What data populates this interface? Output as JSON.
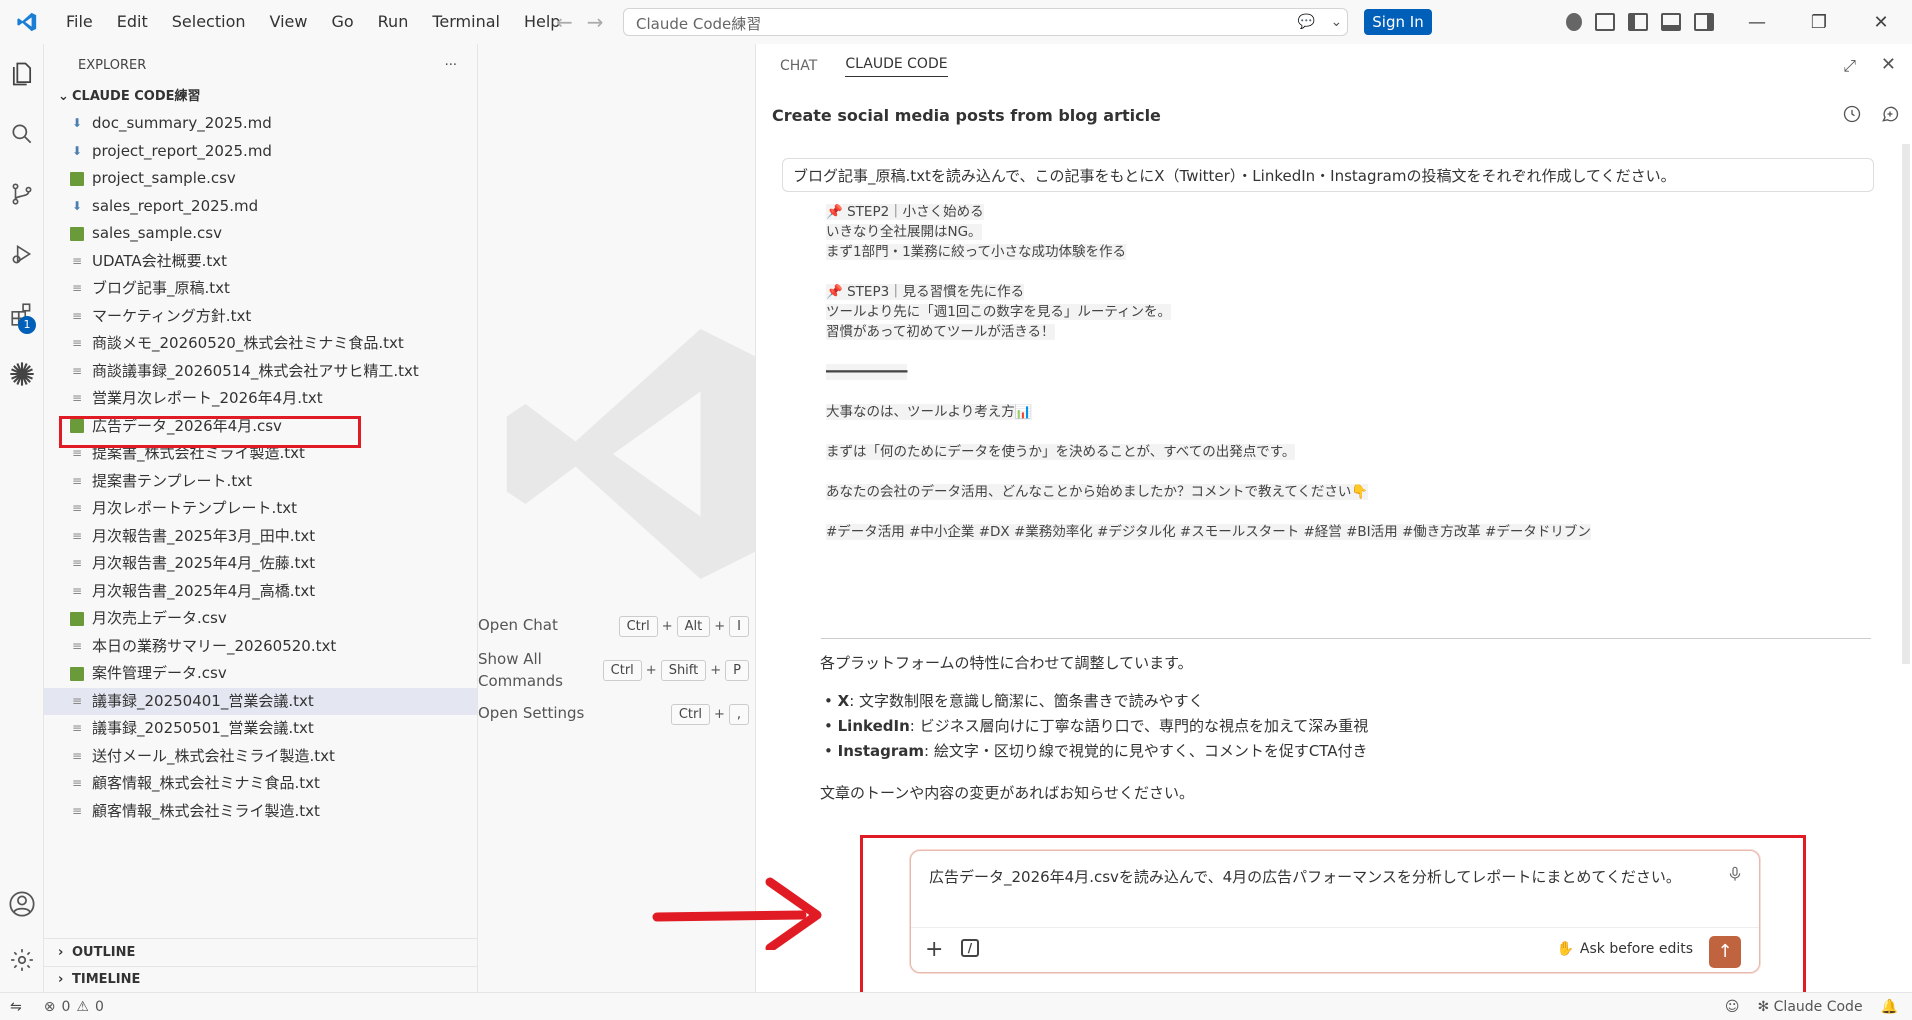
{
  "menu": [
    "File",
    "Edit",
    "Selection",
    "View",
    "Go",
    "Run",
    "Terminal",
    "Help"
  ],
  "search": {
    "placeholder": "Claude Code練習"
  },
  "signin": "Sign In",
  "explorer": {
    "title": "EXPLORER",
    "more": "···",
    "folder": "CLAUDE CODE練習",
    "files": [
      {
        "name": "doc_summary_2025.md",
        "type": "md"
      },
      {
        "name": "project_report_2025.md",
        "type": "md"
      },
      {
        "name": "project_sample.csv",
        "type": "csv"
      },
      {
        "name": "sales_report_2025.md",
        "type": "md"
      },
      {
        "name": "sales_sample.csv",
        "type": "csv"
      },
      {
        "name": "UDATA会社概要.txt",
        "type": "txt"
      },
      {
        "name": "ブログ記事_原稿.txt",
        "type": "txt"
      },
      {
        "name": "マーケティング方針.txt",
        "type": "txt"
      },
      {
        "name": "商談メモ_20260520_株式会社ミナミ食品.txt",
        "type": "txt"
      },
      {
        "name": "商談議事録_20260514_株式会社アサヒ精工.txt",
        "type": "txt"
      },
      {
        "name": "営業月次レポート_2026年4月.txt",
        "type": "txt"
      },
      {
        "name": "広告データ_2026年4月.csv",
        "type": "csv"
      },
      {
        "name": "提案書_株式会社ミライ製造.txt",
        "type": "txt"
      },
      {
        "name": "提案書テンプレート.txt",
        "type": "txt"
      },
      {
        "name": "月次レポートテンプレート.txt",
        "type": "txt"
      },
      {
        "name": "月次報告書_2025年3月_田中.txt",
        "type": "txt"
      },
      {
        "name": "月次報告書_2025年4月_佐藤.txt",
        "type": "txt"
      },
      {
        "name": "月次報告書_2025年4月_高橋.txt",
        "type": "txt"
      },
      {
        "name": "月次売上データ.csv",
        "type": "csv"
      },
      {
        "name": "本日の業務サマリー_20260520.txt",
        "type": "txt"
      },
      {
        "name": "案件管理データ.csv",
        "type": "csv"
      },
      {
        "name": "議事録_20250401_営業会議.txt",
        "type": "txt"
      },
      {
        "name": "議事録_20250501_営業会議.txt",
        "type": "txt"
      },
      {
        "name": "送付メール_株式会社ミライ製造.txt",
        "type": "txt"
      },
      {
        "name": "顧客情報_株式会社ミナミ食品.txt",
        "type": "txt"
      },
      {
        "name": "顧客情報_株式会社ミライ製造.txt",
        "type": "txt"
      }
    ],
    "outline": "OUTLINE",
    "timeline": "TIMELINE"
  },
  "badge_count": "1",
  "editor_shortcuts": [
    {
      "label": "Open Chat",
      "keys": [
        "Ctrl",
        "Alt",
        "I"
      ]
    },
    {
      "label": "Show All Commands",
      "keys": [
        "Ctrl",
        "Shift",
        "P"
      ]
    },
    {
      "label": "Open Settings",
      "keys": [
        "Ctrl",
        ","
      ]
    }
  ],
  "panel": {
    "tabs": [
      "CHAT",
      "CLAUDE CODE"
    ],
    "title": "Create social media posts from blog article",
    "user_message": "ブログ記事_原稿.txtを読み込んで、この記事をもとにX（Twitter）・LinkedIn・Instagramの投稿文をそれぞれ作成してください。",
    "code_lines": [
      "📌 STEP2｜小さく始める",
      "いきなり全社展開はNG。",
      "まず1部門・1業務に絞って小さな成功体験を作る",
      "",
      "📌 STEP3｜見る習慣を先に作る",
      "ツールより先に「週1回この数字を見る」ルーティンを。",
      "習慣があって初めてツールが活きる！",
      "",
      "━━━━━━━━━━",
      "",
      "大事なのは、ツールより考え方📊",
      "",
      "まずは「何のためにデータを使うか」を決めることが、すべての出発点です。",
      "",
      "あなたの会社のデータ活用、どんなことから始めましたか？コメントで教えてください👇",
      "",
      "#データ活用 #中小企業 #DX #業務効率化 #デジタル化 #スモールスタート #経営 #BI活用 #働き方改革 #データドリブン"
    ],
    "summary": "各プラットフォームの特性に合わせて調整しています。",
    "bullets": [
      {
        "k": "X",
        "v": ": 文字数制限を意識し簡潔に、箇条書きで読みやすく"
      },
      {
        "k": "LinkedIn",
        "v": ": ビジネス層向けに丁寧な語り口で、専門的な視点を加えて深み重視"
      },
      {
        "k": "Instagram",
        "v": ": 絵文字・区切り線で視覚的に見やすく、コメントを促すCTA付き"
      }
    ],
    "closing": "文章のトーンや内容の変更があればお知らせください。",
    "input_text": "広告データ_2026年4月.csvを読み込んで、4月の広告パフォーマンスを分析してレポートにまとめてください。",
    "ask_label": "Ask before edits"
  },
  "status": {
    "errors": "0",
    "warnings": "0",
    "right": "✻ Claude Code"
  },
  "colors": {
    "accent": "#005fb8",
    "highlight": "#e01b24",
    "send": "#c0633f"
  }
}
